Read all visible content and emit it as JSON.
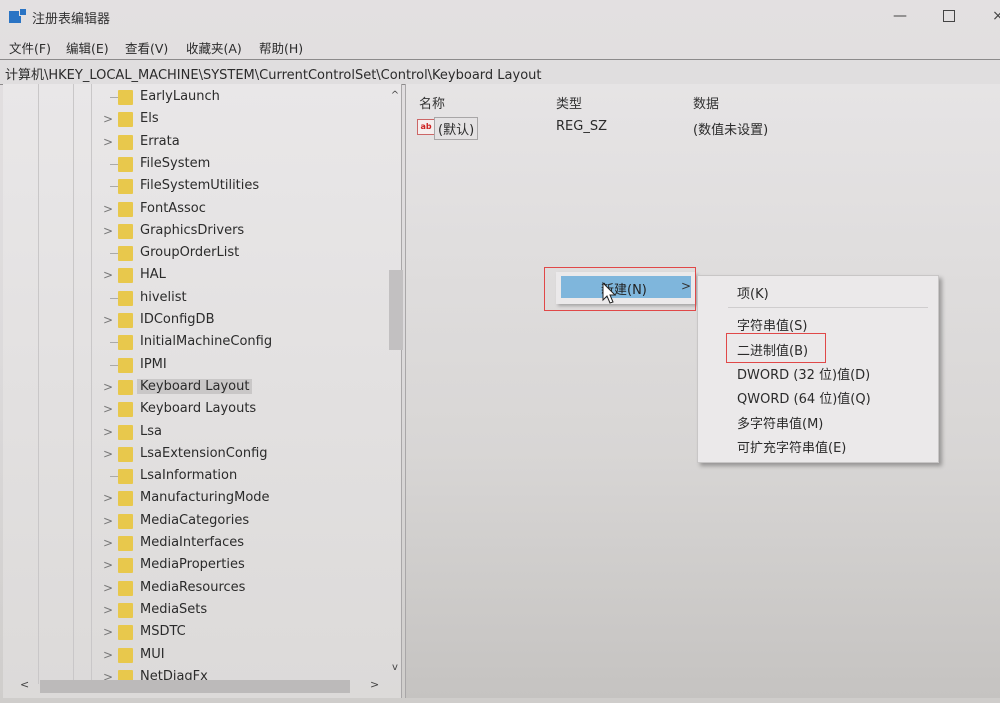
{
  "window": {
    "title": "注册表编辑器",
    "minimize_glyph": "—",
    "close_glyph": "×"
  },
  "menubar": [
    "文件(F)",
    "编辑(E)",
    "查看(V)",
    "收藏夹(A)",
    "帮助(H)"
  ],
  "address": "计算机\\HKEY_LOCAL_MACHINE\\SYSTEM\\CurrentControlSet\\Control\\Keyboard Layout",
  "tree": {
    "items": [
      {
        "label": "EarlyLaunch",
        "expandable": false
      },
      {
        "label": "Els",
        "expandable": true
      },
      {
        "label": "Errata",
        "expandable": true
      },
      {
        "label": "FileSystem",
        "expandable": false
      },
      {
        "label": "FileSystemUtilities",
        "expandable": false
      },
      {
        "label": "FontAssoc",
        "expandable": true
      },
      {
        "label": "GraphicsDrivers",
        "expandable": true
      },
      {
        "label": "GroupOrderList",
        "expandable": false
      },
      {
        "label": "HAL",
        "expandable": true
      },
      {
        "label": "hivelist",
        "expandable": false
      },
      {
        "label": "IDConfigDB",
        "expandable": true
      },
      {
        "label": "InitialMachineConfig",
        "expandable": false
      },
      {
        "label": "IPMI",
        "expandable": false
      },
      {
        "label": "Keyboard Layout",
        "expandable": true,
        "selected": true
      },
      {
        "label": "Keyboard Layouts",
        "expandable": true
      },
      {
        "label": "Lsa",
        "expandable": true
      },
      {
        "label": "LsaExtensionConfig",
        "expandable": true
      },
      {
        "label": "LsaInformation",
        "expandable": false
      },
      {
        "label": "ManufacturingMode",
        "expandable": true
      },
      {
        "label": "MediaCategories",
        "expandable": true
      },
      {
        "label": "MediaInterfaces",
        "expandable": true
      },
      {
        "label": "MediaProperties",
        "expandable": true
      },
      {
        "label": "MediaResources",
        "expandable": true
      },
      {
        "label": "MediaSets",
        "expandable": true
      },
      {
        "label": "MSDTC",
        "expandable": true
      },
      {
        "label": "MUI",
        "expandable": true
      },
      {
        "label": "NetDiagFx",
        "expandable": true
      }
    ],
    "expander_glyph": ">",
    "scroll_up_glyph": "^",
    "scroll_down_glyph": "v",
    "scroll_left_glyph": "<",
    "scroll_right_glyph": ">"
  },
  "list": {
    "columns": [
      "名称",
      "类型",
      "数据"
    ],
    "rows": [
      {
        "icon": "ab",
        "name": "(默认)",
        "type": "REG_SZ",
        "data": "(数值未设置)"
      }
    ]
  },
  "context_menu": {
    "item": "新建(N)",
    "arrow": ">"
  },
  "submenu": {
    "items": [
      "项(K)",
      "字符串值(S)",
      "二进制值(B)",
      "DWORD (32 位)值(D)",
      "QWORD (64 位)值(Q)",
      "多字符串值(M)",
      "可扩充字符串值(E)"
    ]
  },
  "colors": {
    "highlight": "#7fb6dc",
    "annotation_red": "#e04848",
    "folder": "#e8c84c"
  }
}
